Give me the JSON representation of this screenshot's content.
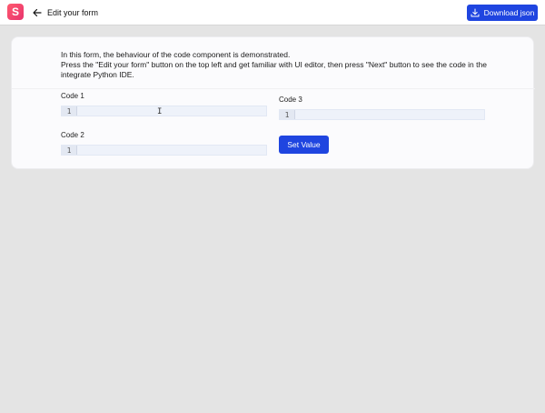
{
  "header": {
    "logo_letter": "S",
    "back_label": "Edit your form",
    "download_label": "Download json"
  },
  "form": {
    "intro_line1": "In this form, the behaviour of the code component is demonstrated.",
    "intro_line2": "Press the \"Edit your form\" button on the top left and get familiar with UI editor, then press \"Next\" button to see the code in the integrate Python IDE.",
    "code1": {
      "label": "Code 1",
      "line_number": "1"
    },
    "code2": {
      "label": "Code 2",
      "line_number": "1"
    },
    "code3": {
      "label": "Code 3",
      "line_number": "1"
    },
    "set_value_label": "Set Value"
  },
  "colors": {
    "accent": "#1f45e0",
    "brand": "#e8336e",
    "background": "#e4e4e4"
  }
}
